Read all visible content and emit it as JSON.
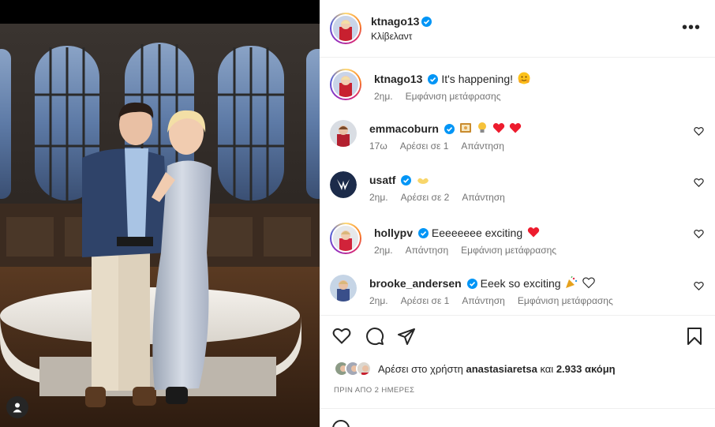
{
  "post": {
    "author": "ktnago13",
    "location": "Κλίβελαντ"
  },
  "caption": {
    "username": "ktnago13",
    "text": "It's happening!",
    "emoji": "hugging-face",
    "time": "2ημ.",
    "translate": "Εμφάνιση μετάφρασης"
  },
  "comments": [
    {
      "username": "emmacoburn",
      "text": "",
      "emojis": [
        "framed-picture",
        "lightbulb",
        "red-heart",
        "red-heart"
      ],
      "time": "17ω",
      "likes": "Αρέσει σε 1",
      "reply": "Απάντηση",
      "translate": ""
    },
    {
      "username": "usatf",
      "text": "",
      "emojis": [
        "heart-hands"
      ],
      "time": "2ημ.",
      "likes": "Αρέσει σε 2",
      "reply": "Απάντηση",
      "translate": ""
    },
    {
      "username": "hollypv",
      "text": "Eeeeeeee exciting",
      "emojis": [
        "red-heart"
      ],
      "time": "2ημ.",
      "likes": "",
      "reply": "Απάντηση",
      "translate": "Εμφάνιση μετάφρασης"
    },
    {
      "username": "brooke_andersen",
      "text": "Eeek so exciting",
      "emojis": [
        "party-popper",
        "white-heart"
      ],
      "time": "2ημ.",
      "likes": "Αρέσει σε 1",
      "reply": "Απάντηση",
      "translate": "Εμφάνιση μετάφρασης"
    }
  ],
  "likes": {
    "prefix": "Αρέσει στο χρήστη",
    "user": "anastasiaretsa",
    "and": "και",
    "count": "2.933 ακόμη"
  },
  "timestamp": "ΠΡΙΝ ΑΠΟ 2 ΗΜΕΡΕΣ",
  "colors": {
    "verified": "#0095f6",
    "heart": "#ed4956",
    "muted": "#737373"
  }
}
